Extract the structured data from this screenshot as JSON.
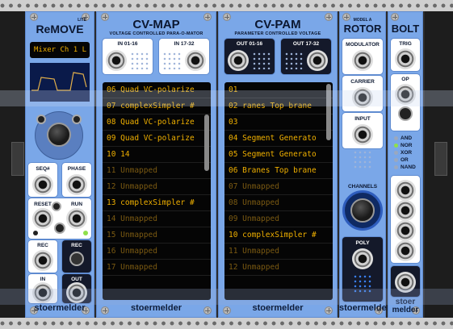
{
  "rack": {
    "remove": {
      "brand": "stoermelder",
      "title": "ReMOVE",
      "tag": "LITE",
      "display_text": "Mixer Ch 1 L",
      "labels": {
        "seq": "SEQ#",
        "phase": "PHASE",
        "reset": "RESET",
        "run": "RUN",
        "rec_in": "REC",
        "rec_btn": "REC",
        "in": "IN",
        "out": "OUT"
      }
    },
    "cvmap": {
      "brand": "stoermelder",
      "title": "CV-MAP",
      "subtitle": "VOLTAGE CONTROLLED PARA-O-MATOR",
      "in1": "IN 01-16",
      "in2": "IN 17-32",
      "rows": [
        {
          "text": "06 Quad VC-polarize",
          "active": true
        },
        {
          "text": "07 complexSimpler #",
          "active": true
        },
        {
          "text": "08 Quad VC-polarize",
          "active": true
        },
        {
          "text": "09 Quad VC-polarize",
          "active": true
        },
        {
          "text": "10 14",
          "active": true
        },
        {
          "text": "11 Unmapped",
          "active": false
        },
        {
          "text": "12 Unmapped",
          "active": false
        },
        {
          "text": "13 complexSimpler #",
          "active": true
        },
        {
          "text": "14 Unmapped",
          "active": false
        },
        {
          "text": "15 Unmapped",
          "active": false
        },
        {
          "text": "16 Unmapped",
          "active": false
        },
        {
          "text": "17 Unmapped",
          "active": false
        }
      ]
    },
    "cvpam": {
      "brand": "stoermelder",
      "title": "CV-PAM",
      "subtitle": "PARAMETER CONTROLLED VOLTAGE",
      "out1": "OUT 01-16",
      "out2": "OUT 17-32",
      "rows": [
        {
          "text": "01",
          "active": true
        },
        {
          "text": "02 ranes Top brane",
          "active": true
        },
        {
          "text": "03",
          "active": true
        },
        {
          "text": "04 Segment Generato",
          "active": true
        },
        {
          "text": "05 Segment Generato",
          "active": true
        },
        {
          "text": "06 Branes Top brane",
          "active": true
        },
        {
          "text": "07 Unmapped",
          "active": false
        },
        {
          "text": "08 Unmapped",
          "active": false
        },
        {
          "text": "09 Unmapped",
          "active": false
        },
        {
          "text": "10 complexSimpler #",
          "active": true
        },
        {
          "text": "11 Unmapped",
          "active": false
        },
        {
          "text": "12 Unmapped",
          "active": false
        }
      ]
    },
    "rotor": {
      "brand": "stoermelder",
      "title": "ROTOR",
      "tag": "MODEL A",
      "modulator": "MODULATOR",
      "carrier": "CARRIER",
      "input": "INPUT",
      "channels": "CHANNELS",
      "poly": "POLY"
    },
    "bolt": {
      "brand": "stoer\nmelder",
      "brand_line1": "stoer",
      "brand_line2": "melder",
      "title": "BOLT",
      "trig": "TRIG",
      "op": "OP",
      "ops": [
        {
          "label": "AND",
          "color": "#9aa8bf"
        },
        {
          "label": "NOR",
          "color": "#8fe04a"
        },
        {
          "label": "XOR",
          "color": "#9aa8bf"
        },
        {
          "label": "OR",
          "color": "#9aa8bf"
        },
        {
          "label": "NAND",
          "color": "#9aa8bf"
        }
      ]
    }
  },
  "colors": {
    "panel": "#7aa7e8",
    "lcd_on": "#f0b000",
    "lcd_off": "#7b5a12",
    "led_green": "#8fe04a"
  }
}
